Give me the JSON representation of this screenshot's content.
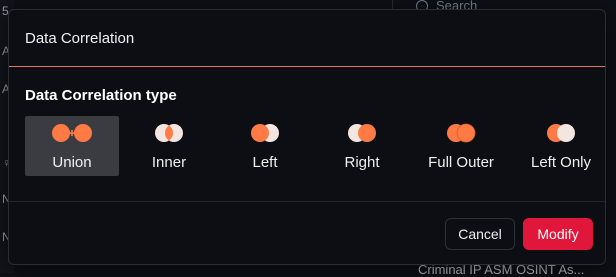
{
  "background": {
    "left_chars": [
      "5",
      "A1",
      "A2",
      "♀",
      "N",
      "N"
    ],
    "search_placeholder": "Search",
    "bottom_text": "Criminal IP ASM OSINT As..."
  },
  "modal": {
    "title": "Data Correlation",
    "section_title": "Data Correlation type",
    "options": [
      {
        "label": "Union",
        "icon": "union-venn-icon",
        "selected": true
      },
      {
        "label": "Inner",
        "icon": "inner-venn-icon",
        "selected": false
      },
      {
        "label": "Left",
        "icon": "left-venn-icon",
        "selected": false
      },
      {
        "label": "Right",
        "icon": "right-venn-icon",
        "selected": false
      },
      {
        "label": "Full Outer",
        "icon": "full-outer-venn-icon",
        "selected": false
      },
      {
        "label": "Left Only",
        "icon": "left-only-venn-icon",
        "selected": false
      }
    ],
    "cancel_label": "Cancel",
    "modify_label": "Modify"
  },
  "colors": {
    "accent_orange": "#ff7a45",
    "light_circle": "#f3e6e0",
    "primary_button": "#e0163a",
    "header_divider": "#e07a5a"
  }
}
